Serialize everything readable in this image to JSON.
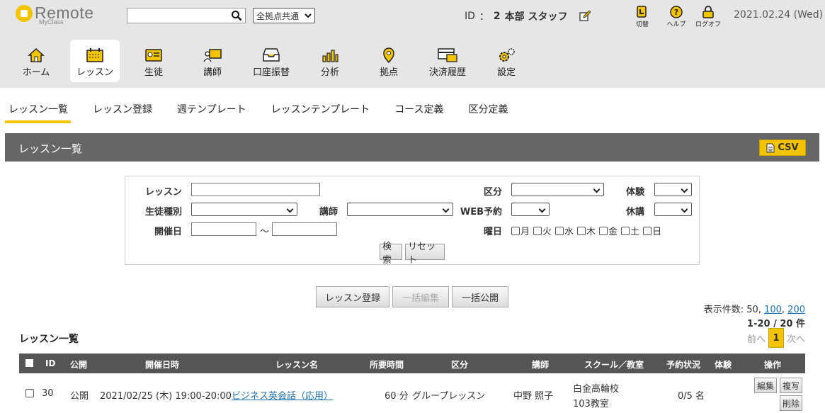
{
  "brand": {
    "name": "Remote",
    "sub": "MyClass"
  },
  "search": {
    "value": "",
    "placeholder": ""
  },
  "scope": {
    "selected": "全拠点共通"
  },
  "user": {
    "id_label": "ID",
    "sep": "：",
    "id": "2",
    "name": "本部 スタッフ"
  },
  "tools": [
    {
      "label": "切替",
      "icon": "switch-icon"
    },
    {
      "label": "ヘルプ",
      "icon": "help-icon"
    },
    {
      "label": "ログオフ",
      "icon": "lock-icon"
    }
  ],
  "date": "2021.02.24 (Wed)",
  "nav": [
    {
      "label": "ホーム",
      "icon": "home-icon"
    },
    {
      "label": "レッスン",
      "icon": "calendar-icon",
      "active": true
    },
    {
      "label": "生徒",
      "icon": "id-card-icon"
    },
    {
      "label": "講師",
      "icon": "teacher-icon"
    },
    {
      "label": "口座振替",
      "icon": "inbox-icon"
    },
    {
      "label": "分析",
      "icon": "bar-chart-icon"
    },
    {
      "label": "拠点",
      "icon": "map-pin-icon"
    },
    {
      "label": "決済履歴",
      "icon": "payment-icon"
    },
    {
      "label": "設定",
      "icon": "gear-icon"
    }
  ],
  "subnav": [
    {
      "label": "レッスン一覧",
      "active": true
    },
    {
      "label": "レッスン登録"
    },
    {
      "label": "週テンプレート"
    },
    {
      "label": "レッスンテンプレート"
    },
    {
      "label": "コース定義"
    },
    {
      "label": "区分定義"
    }
  ],
  "section": {
    "title": "レッスン一覧",
    "csv": "CSV"
  },
  "form": {
    "lesson": "レッスン",
    "category": "区分",
    "trial": "体験",
    "student_type": "生徒種別",
    "teacher": "講師",
    "web": "WEB予約",
    "cancel": "休講",
    "date": "開催日",
    "tilde": "～",
    "weekday": "曜日",
    "days": [
      "月",
      "火",
      "水",
      "木",
      "金",
      "土",
      "日"
    ],
    "search_btn": "検索",
    "reset_btn": "リセット"
  },
  "actions": {
    "register": "レッスン登録",
    "bulk_edit": "一括編集",
    "bulk_publish": "一括公開"
  },
  "perpage": {
    "label": "表示件数: 50,",
    "opt1": "100",
    "sep": ",",
    "opt2": "200"
  },
  "count": "1-20  /  20 件",
  "pager": {
    "prev": "前へ",
    "current": "1",
    "next": "次へ"
  },
  "list_title": "レッスン一覧",
  "table": {
    "headers": [
      "ID",
      "公開",
      "開催日時",
      "レッスン名",
      "所要時間",
      "区分",
      "講師",
      "スクール／教室",
      "予約状況",
      "体験",
      "操作"
    ],
    "rows": [
      {
        "id": "30",
        "public": "公開",
        "datetime": "2021/02/25 (木) 19:00-20:00",
        "name": "ビジネス英会話（応用）",
        "duration": "60 分",
        "category": "グループレッスン",
        "teacher": "中野 照子",
        "school": "白金高輪校",
        "room": "103教室",
        "reservation": "0/5 名",
        "trial": "",
        "edit": "編集",
        "copy": "複写",
        "delete": "削除"
      }
    ]
  }
}
